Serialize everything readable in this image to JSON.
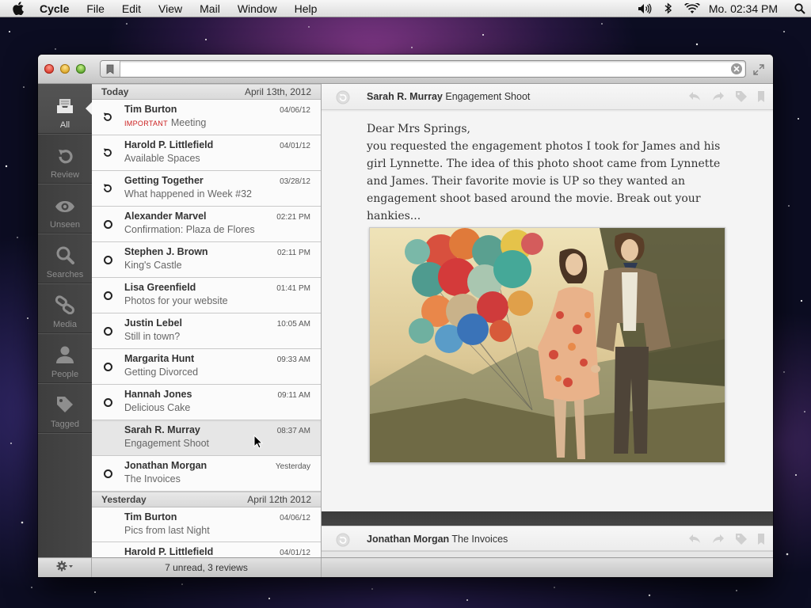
{
  "menubar": {
    "app_name": "Cycle",
    "items": [
      "File",
      "Edit",
      "View",
      "Mail",
      "Window",
      "Help"
    ],
    "clock": "Mo. 02:34 PM",
    "status_icons": [
      "volume-icon",
      "bluetooth-icon",
      "wifi-icon",
      "spotlight-icon"
    ]
  },
  "window": {
    "search_value": "",
    "search_placeholder": ""
  },
  "sidebar": {
    "items": [
      {
        "label": "All",
        "icon": "inbox-tray-icon",
        "active": true
      },
      {
        "label": "Review",
        "icon": "review-arrow-icon"
      },
      {
        "label": "Unseen",
        "icon": "eye-icon"
      },
      {
        "label": "Searches",
        "icon": "magnifier-icon"
      },
      {
        "label": "Media",
        "icon": "chain-link-icon"
      },
      {
        "label": "People",
        "icon": "person-icon"
      },
      {
        "label": "Tagged",
        "icon": "tag-icon"
      }
    ]
  },
  "list": {
    "today": {
      "title": "Today",
      "date": "April 13th, 2012"
    },
    "yesterday": {
      "title": "Yesterday",
      "date": "April 12th 2012"
    },
    "messages": [
      {
        "sender": "Tim Burton",
        "tag": "IMPORTANT",
        "subject": "Meeting",
        "time": "04/06/12",
        "state": "review"
      },
      {
        "sender": "Harold P. Littlefield",
        "tag": "",
        "subject": "Available Spaces",
        "time": "04/01/12",
        "state": "review"
      },
      {
        "sender": "Getting Together",
        "tag": "",
        "subject": "What happened in Week #32",
        "time": "03/28/12",
        "state": "review"
      },
      {
        "sender": "Alexander Marvel",
        "tag": "",
        "subject": "Confirmation: Plaza de Flores",
        "time": "02:21 PM",
        "state": "unread"
      },
      {
        "sender": "Stephen J. Brown",
        "tag": "",
        "subject": "King's Castle",
        "time": "02:11 PM",
        "state": "unread"
      },
      {
        "sender": "Lisa Greenfield",
        "tag": "",
        "subject": "Photos for your website",
        "time": "01:41 PM",
        "state": "unread"
      },
      {
        "sender": "Justin Lebel",
        "tag": "",
        "subject": "Still in town?",
        "time": "10:05 AM",
        "state": "unread"
      },
      {
        "sender": "Margarita Hunt",
        "tag": "",
        "subject": "Getting Divorced",
        "time": "09:33 AM",
        "state": "unread"
      },
      {
        "sender": "Hannah Jones",
        "tag": "",
        "subject": "Delicious Cake",
        "time": "09:11 AM",
        "state": "unread"
      },
      {
        "sender": "Sarah R. Murray",
        "tag": "",
        "subject": "Engagement Shoot",
        "time": "08:37 AM",
        "state": "read"
      },
      {
        "sender": "Jonathan Morgan",
        "tag": "",
        "subject": "The Invoices",
        "time": "Yesterday",
        "state": "unread"
      }
    ],
    "yesterday_messages": [
      {
        "sender": "Tim Burton",
        "subject": "Pics from last Night",
        "time": "04/06/12"
      },
      {
        "sender": "Harold P. Littlefield",
        "subject": "",
        "time": "04/01/12"
      }
    ]
  },
  "status": {
    "count": "7 unread, 3 reviews"
  },
  "reader": {
    "sender": "Sarah R. Murray",
    "subject": "Engagement Shoot",
    "greeting": "Dear Mrs Springs,",
    "body": "you requested the engagement photos I took for James and his girl Lynnette. The idea of this photo shoot came from Lynnette and James. Their favorite movie is UP so they wanted an engagement shoot based around the movie. Break out your hankies...",
    "next_sender": "Jonathan Morgan",
    "next_subject": "The Invoices"
  },
  "colors": {
    "important_tag": "#cc1f1f",
    "sidebar_bg": "#444444"
  }
}
